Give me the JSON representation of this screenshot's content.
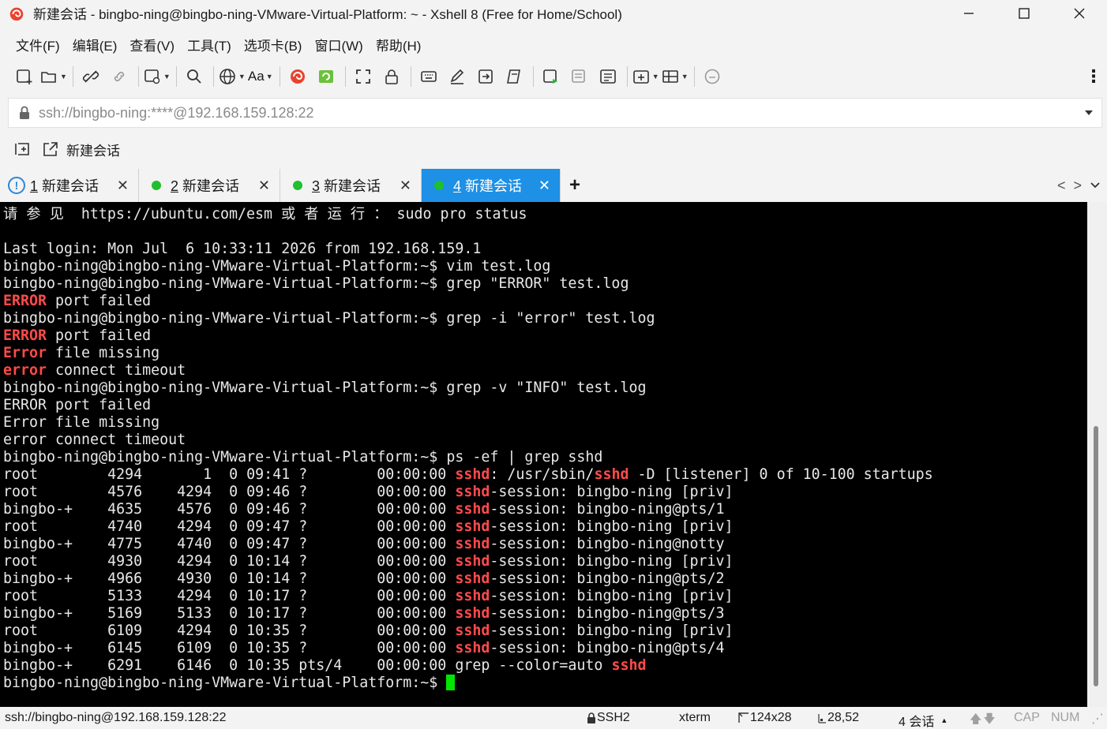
{
  "window": {
    "title": "新建会话 - bingbo-ning@bingbo-ning-VMware-Virtual-Platform: ~ - Xshell 8 (Free for Home/School)"
  },
  "menu": [
    "文件(F)",
    "编辑(E)",
    "查看(V)",
    "工具(T)",
    "选项卡(B)",
    "窗口(W)",
    "帮助(H)"
  ],
  "toolbar": {
    "font_label": "Aa"
  },
  "address": {
    "value": "ssh://bingbo-ning:****@192.168.159.128:22"
  },
  "links": {
    "new_session_label": "新建会话"
  },
  "tabs": [
    {
      "num": "1",
      "label": "新建会话",
      "status": "warning",
      "active": false
    },
    {
      "num": "2",
      "label": "新建会话",
      "status": "connected",
      "active": false
    },
    {
      "num": "3",
      "label": "新建会话",
      "status": "connected",
      "active": false
    },
    {
      "num": "4",
      "label": "新建会话",
      "status": "connected",
      "active": true
    }
  ],
  "terminal": {
    "lines": [
      [
        [
          "请 参 见  https://ubuntu.com/esm 或 者 运 行 ： sudo pro status",
          false
        ]
      ],
      [
        [
          "",
          false
        ]
      ],
      [
        [
          "Last login: Mon Jul  6 10:33:11 2026 from 192.168.159.1",
          false
        ]
      ],
      [
        [
          "bingbo-ning@bingbo-ning-VMware-Virtual-Platform:~$ vim test.log",
          false
        ]
      ],
      [
        [
          "bingbo-ning@bingbo-ning-VMware-Virtual-Platform:~$ grep \"ERROR\" test.log",
          false
        ]
      ],
      [
        [
          "ERROR",
          true
        ],
        [
          " port failed",
          false
        ]
      ],
      [
        [
          "bingbo-ning@bingbo-ning-VMware-Virtual-Platform:~$ grep -i \"error\" test.log",
          false
        ]
      ],
      [
        [
          "ERROR",
          true
        ],
        [
          " port failed",
          false
        ]
      ],
      [
        [
          "Error",
          true
        ],
        [
          " file missing",
          false
        ]
      ],
      [
        [
          "error",
          true
        ],
        [
          " connect timeout",
          false
        ]
      ],
      [
        [
          "bingbo-ning@bingbo-ning-VMware-Virtual-Platform:~$ grep -v \"INFO\" test.log",
          false
        ]
      ],
      [
        [
          "ERROR port failed",
          false
        ]
      ],
      [
        [
          "Error file missing",
          false
        ]
      ],
      [
        [
          "error connect timeout",
          false
        ]
      ],
      [
        [
          "bingbo-ning@bingbo-ning-VMware-Virtual-Platform:~$ ps -ef | grep sshd",
          false
        ]
      ],
      [
        [
          "root        4294       1  0 09:41 ?        00:00:00 ",
          false
        ],
        [
          "sshd",
          true
        ],
        [
          ": /usr/sbin/",
          false
        ],
        [
          "sshd",
          true
        ],
        [
          " -D [listener] 0 of 10-100 startups",
          false
        ]
      ],
      [
        [
          "root        4576    4294  0 09:46 ?        00:00:00 ",
          false
        ],
        [
          "sshd",
          true
        ],
        [
          "-session: bingbo-ning [priv]",
          false
        ]
      ],
      [
        [
          "bingbo-+    4635    4576  0 09:46 ?        00:00:00 ",
          false
        ],
        [
          "sshd",
          true
        ],
        [
          "-session: bingbo-ning@pts/1",
          false
        ]
      ],
      [
        [
          "root        4740    4294  0 09:47 ?        00:00:00 ",
          false
        ],
        [
          "sshd",
          true
        ],
        [
          "-session: bingbo-ning [priv]",
          false
        ]
      ],
      [
        [
          "bingbo-+    4775    4740  0 09:47 ?        00:00:00 ",
          false
        ],
        [
          "sshd",
          true
        ],
        [
          "-session: bingbo-ning@notty",
          false
        ]
      ],
      [
        [
          "root        4930    4294  0 10:14 ?        00:00:00 ",
          false
        ],
        [
          "sshd",
          true
        ],
        [
          "-session: bingbo-ning [priv]",
          false
        ]
      ],
      [
        [
          "bingbo-+    4966    4930  0 10:14 ?        00:00:00 ",
          false
        ],
        [
          "sshd",
          true
        ],
        [
          "-session: bingbo-ning@pts/2",
          false
        ]
      ],
      [
        [
          "root        5133    4294  0 10:17 ?        00:00:00 ",
          false
        ],
        [
          "sshd",
          true
        ],
        [
          "-session: bingbo-ning [priv]",
          false
        ]
      ],
      [
        [
          "bingbo-+    5169    5133  0 10:17 ?        00:00:00 ",
          false
        ],
        [
          "sshd",
          true
        ],
        [
          "-session: bingbo-ning@pts/3",
          false
        ]
      ],
      [
        [
          "root        6109    4294  0 10:35 ?        00:00:00 ",
          false
        ],
        [
          "sshd",
          true
        ],
        [
          "-session: bingbo-ning [priv]",
          false
        ]
      ],
      [
        [
          "bingbo-+    6145    6109  0 10:35 ?        00:00:00 ",
          false
        ],
        [
          "sshd",
          true
        ],
        [
          "-session: bingbo-ning@pts/4",
          false
        ]
      ],
      [
        [
          "bingbo-+    6291    6146  0 10:35 pts/4    00:00:00 grep --color=auto ",
          false
        ],
        [
          "sshd",
          true
        ]
      ],
      [
        [
          "bingbo-ning@bingbo-ning-VMware-Virtual-Platform:~$ ",
          false
        ]
      ]
    ]
  },
  "status": {
    "connection": "ssh://bingbo-ning@192.168.159.128:22",
    "protocol": "SSH2",
    "term": "xterm",
    "size": "124x28",
    "cursor_pos": "28,52",
    "sessions": "4 会话",
    "cap": "CAP",
    "num": "NUM"
  },
  "colors": {
    "accent": "#1e90e6",
    "highlight": "#ff4a4a",
    "connected": "#1fbf2f",
    "cursor": "#00e600"
  }
}
